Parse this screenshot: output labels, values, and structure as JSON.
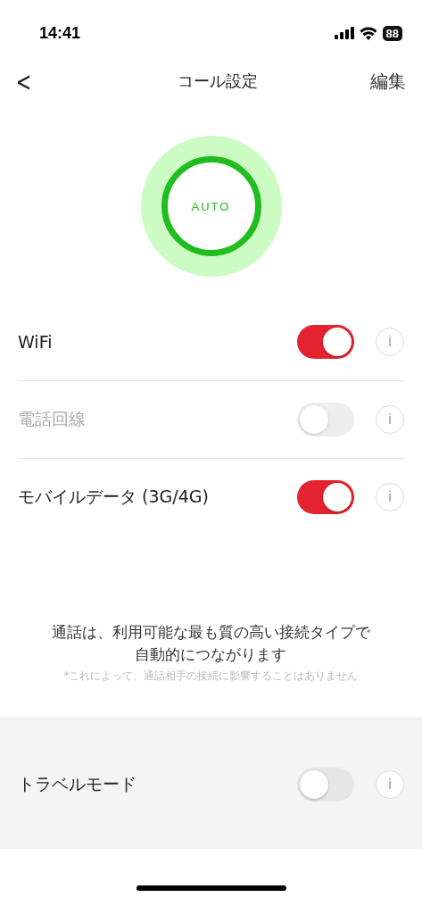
{
  "status_bar": {
    "time": "14:41",
    "battery": "88"
  },
  "nav": {
    "back": "<",
    "title": "コール設定",
    "action": "編集"
  },
  "mode": {
    "label": "AUTO"
  },
  "settings": [
    {
      "label": "WiFi",
      "on": true,
      "disabled": false,
      "info": "i"
    },
    {
      "label": "電話回線",
      "on": false,
      "disabled": true,
      "info": "i"
    },
    {
      "label": "モバイルデータ (3G/4G)",
      "on": true,
      "disabled": false,
      "info": "i"
    }
  ],
  "description": {
    "text": "通話は、利用可能な最も質の高い接続タイプで自動的につながります",
    "note": "*これによって、通話相手の接続に影響することはありません"
  },
  "travel": {
    "label": "トラベルモード",
    "on": false,
    "disabled": false,
    "info": "i"
  }
}
